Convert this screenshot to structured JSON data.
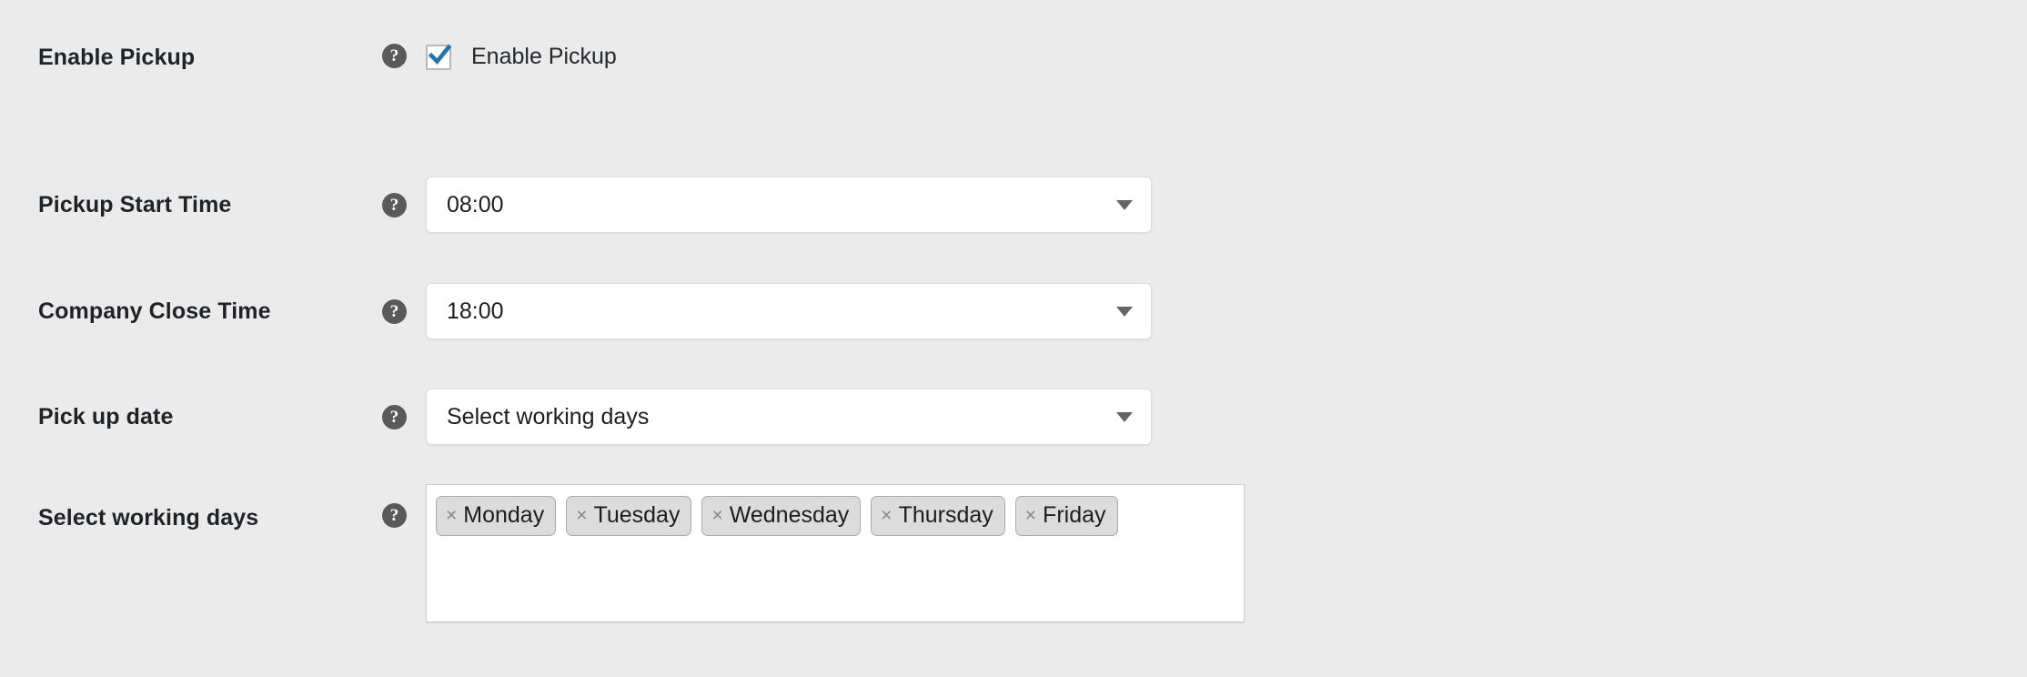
{
  "form": {
    "rows": [
      {
        "label": "Enable Pickup",
        "help_icon": "help-question-icon",
        "type": "checkbox",
        "checkbox_label": "Enable Pickup",
        "checked": true
      },
      {
        "label": "Pickup Start Time",
        "help_icon": "help-question-icon",
        "type": "select",
        "value": "08:00"
      },
      {
        "label": "Company Close Time",
        "help_icon": "help-question-icon",
        "type": "select",
        "value": "18:00"
      },
      {
        "label": "Pick up date",
        "help_icon": "help-question-icon",
        "type": "select",
        "value": "Select working days"
      },
      {
        "label": "Select working days",
        "help_icon": "help-question-icon",
        "type": "tags",
        "tags": [
          {
            "text": "Monday",
            "remove": "×"
          },
          {
            "text": "Tuesday",
            "remove": "×"
          },
          {
            "text": "Wednesday",
            "remove": "×"
          },
          {
            "text": "Thursday",
            "remove": "×"
          },
          {
            "text": "Friday",
            "remove": "×"
          }
        ]
      }
    ]
  },
  "icons": {
    "help_glyph": "?"
  },
  "colors": {
    "page_background": "#ebebeb",
    "checkbox_accent": "#1f74b3",
    "label_text": "#1d2327",
    "help_icon_background": "#5a5a5a",
    "tag_background": "#dcdcdc",
    "tag_border": "#a9a9a9",
    "field_background": "#ffffff"
  }
}
